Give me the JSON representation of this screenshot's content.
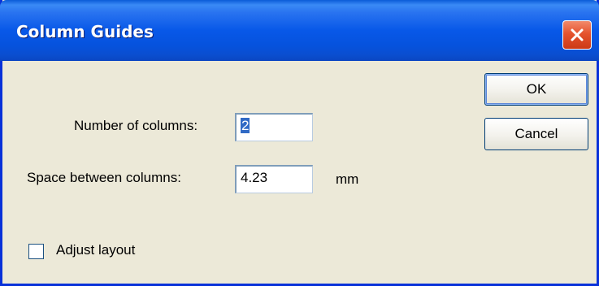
{
  "window": {
    "title": "Column Guides",
    "close_icon": "close-icon"
  },
  "form": {
    "num_columns_label": "Number of columns:",
    "num_columns_value": "2",
    "space_label": "Space between columns:",
    "space_value": "4.23",
    "space_unit": "mm",
    "adjust_layout_label": "Adjust layout",
    "adjust_layout_checked": false
  },
  "buttons": {
    "ok_label": "OK",
    "cancel_label": "Cancel"
  },
  "colors": {
    "titlebar": "#0858e8",
    "dialog_bg": "#ece9d8",
    "close": "#e5532e",
    "selection": "#316ac5"
  }
}
